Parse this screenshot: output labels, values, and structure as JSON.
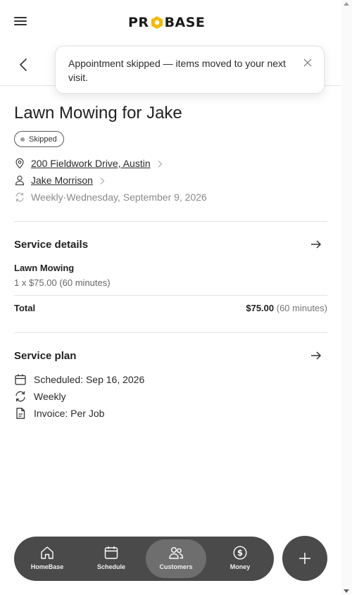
{
  "header": {
    "logo_text_left": "PR",
    "logo_text_right": "BASE"
  },
  "toast": {
    "message": "Appointment skipped — items moved to your next visit."
  },
  "appointment": {
    "title": "Lawn Mowing for Jake",
    "status": "Skipped",
    "address": "200 Fieldwork Drive, Austin",
    "customer": "Jake Morrison",
    "recurrence": "Weekly",
    "separator": " · ",
    "date": "Wednesday, September 9, 2026"
  },
  "service_details": {
    "heading": "Service details",
    "item_name": "Lawn Mowing",
    "item_sub": "1 x $75.00 (60 minutes)",
    "total_label": "Total",
    "total_amount": "$75.00",
    "total_duration": " (60 minutes)"
  },
  "service_plan": {
    "heading": "Service plan",
    "scheduled": "Scheduled: Sep 16, 2026",
    "frequency": "Weekly",
    "invoice": "Invoice: Per Job"
  },
  "bottom_nav": {
    "items": [
      {
        "label": "HomeBase",
        "icon": "house-icon"
      },
      {
        "label": "Schedule",
        "icon": "calendar-icon"
      },
      {
        "label": "Customers",
        "icon": "people-icon",
        "active": true
      },
      {
        "label": "Money",
        "icon": "dollar-icon"
      }
    ],
    "fab_icon": "plus-icon"
  },
  "colors": {
    "accent_logo": "#f5b800",
    "nav_bg": "#4a4a4a",
    "nav_active": "#6e6e6e"
  }
}
